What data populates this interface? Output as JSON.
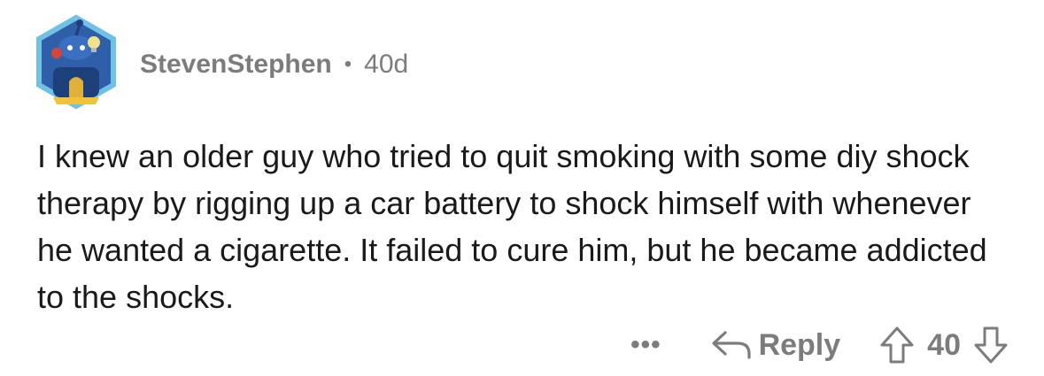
{
  "comment": {
    "author": "StevenStephen",
    "separator": "•",
    "age": "40d",
    "body": "I knew an older guy who tried to quit smoking with some diy shock therapy by rigging up a car battery to shock himself with whenever he wanted a cigarette. It failed to cure him, but he became addicted to the shocks."
  },
  "actions": {
    "more_label": "•••",
    "reply_label": "Reply",
    "score": "40"
  },
  "icons": {
    "avatar": "snoo-avatar-icon",
    "reply": "reply-arrow-icon",
    "upvote": "upvote-arrow-icon",
    "downvote": "downvote-arrow-icon"
  },
  "colors": {
    "text": "#1a1a1b",
    "meta": "#7c7c7c",
    "avatar_border": "#53a6d6",
    "avatar_fill": "#2f5fa8"
  }
}
